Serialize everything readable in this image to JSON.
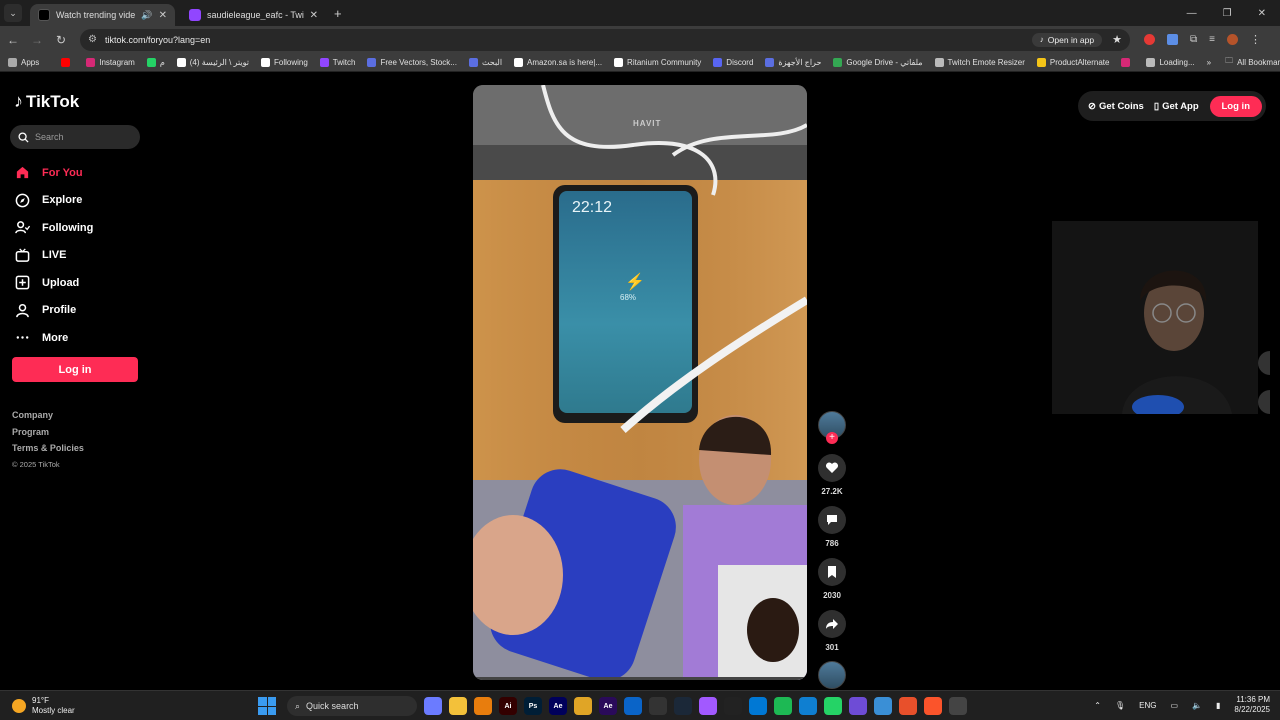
{
  "browser": {
    "tabs": [
      {
        "title": "Watch trending videos for y",
        "active": true
      },
      {
        "title": "saudieleague_eafc - Twitch",
        "active": false
      }
    ],
    "url": "tiktok.com/foryou?lang=en",
    "open_in_app": "Open in app",
    "bookmarks": [
      {
        "label": "Apps",
        "color": "#aaaaaa"
      },
      {
        "label": "",
        "color": "#ff0000"
      },
      {
        "label": "Instagram",
        "color": "#d62976"
      },
      {
        "label": "م",
        "color": "#25d366"
      },
      {
        "label": "(4) تويتر \\ الرئيسة",
        "color": "#ffffff"
      },
      {
        "label": "Following",
        "color": "#ffffff"
      },
      {
        "label": "Twitch",
        "color": "#9146ff"
      },
      {
        "label": "Free Vectors, Stock...",
        "color": "#5b6ee1"
      },
      {
        "label": "البحث",
        "color": "#5b6ee1"
      },
      {
        "label": "Amazon.sa is here|...",
        "color": "#ffffff"
      },
      {
        "label": "Ritanium Community",
        "color": "#ffffff"
      },
      {
        "label": "Discord",
        "color": "#5865f2"
      },
      {
        "label": "حراج الأجهزة",
        "color": "#5b6ee1"
      },
      {
        "label": "Google Drive - ملفاتي",
        "color": "#34a853"
      },
      {
        "label": "Twitch Emote Resizer",
        "color": "#bbbbbb"
      },
      {
        "label": "ProductAlternate",
        "color": "#f5c518"
      },
      {
        "label": "",
        "color": "#d62976"
      },
      {
        "label": "Loading...",
        "color": "#bbbbbb"
      }
    ],
    "all_bookmarks": "All Bookmarks"
  },
  "tiktok": {
    "logo": "TikTok",
    "search_placeholder": "Search",
    "nav": [
      {
        "label": "For You",
        "icon": "home-icon",
        "active": true
      },
      {
        "label": "Explore",
        "icon": "compass-icon",
        "active": false
      },
      {
        "label": "Following",
        "icon": "following-icon",
        "active": false
      },
      {
        "label": "LIVE",
        "icon": "live-icon",
        "active": false
      },
      {
        "label": "Upload",
        "icon": "upload-icon",
        "active": false
      },
      {
        "label": "Profile",
        "icon": "profile-icon",
        "active": false
      },
      {
        "label": "More",
        "icon": "more-icon",
        "active": false
      }
    ],
    "login": "Log in",
    "footer": {
      "links": [
        "Company",
        "Program",
        "Terms & Policies"
      ],
      "copyright": "© 2025 TikTok"
    },
    "top": {
      "get_coins": "Get Coins",
      "get_app": "Get App",
      "login": "Log in"
    },
    "video": {
      "phone_time": "22:12",
      "charge_percent": "68%",
      "brand_label": "HAVIT"
    },
    "actions": {
      "likes": "27.2K",
      "comments": "786",
      "saves": "2030",
      "shares": "301"
    },
    "accent": "#fe2c55"
  },
  "taskbar": {
    "weather_temp": "91°F",
    "weather_desc": "Mostly clear",
    "search_label": "Quick search",
    "apps": [
      {
        "name": "copilot",
        "label": "",
        "color": "#6b7bff"
      },
      {
        "name": "explorer",
        "label": "",
        "color": "#f3c13a"
      },
      {
        "name": "blender",
        "label": "",
        "color": "#e87d0d"
      },
      {
        "name": "illustrator",
        "label": "Ai",
        "color": "#330000"
      },
      {
        "name": "photoshop",
        "label": "Ps",
        "color": "#001e36"
      },
      {
        "name": "after-effects",
        "label": "Ae",
        "color": "#00005b"
      },
      {
        "name": "chrome",
        "label": "",
        "color": "#e0a526"
      },
      {
        "name": "premiere",
        "label": "Ae",
        "color": "#2a0a5a"
      },
      {
        "name": "outlook",
        "label": "",
        "color": "#0a64c8"
      },
      {
        "name": "chatgpt",
        "label": "",
        "color": "#333333"
      },
      {
        "name": "steam",
        "label": "",
        "color": "#1b2838"
      },
      {
        "name": "figma",
        "label": "",
        "color": "#a259ff"
      },
      {
        "name": "dot",
        "label": "",
        "color": "#222222"
      },
      {
        "name": "store",
        "label": "",
        "color": "#0078d4"
      },
      {
        "name": "spotify",
        "label": "",
        "color": "#1db954"
      },
      {
        "name": "edge",
        "label": "",
        "color": "#0f7fd1"
      },
      {
        "name": "whatsapp",
        "label": "",
        "color": "#25d366"
      },
      {
        "name": "app-purple",
        "label": "",
        "color": "#6e4cd6"
      },
      {
        "name": "app-files",
        "label": "",
        "color": "#3a8fd6"
      },
      {
        "name": "app-orange",
        "label": "",
        "color": "#e8502b"
      },
      {
        "name": "brave",
        "label": "",
        "color": "#fb542b"
      },
      {
        "name": "obs",
        "label": "",
        "color": "#444444"
      }
    ],
    "lang": "ENG",
    "time": "11:36 PM",
    "date": "8/22/2025"
  }
}
